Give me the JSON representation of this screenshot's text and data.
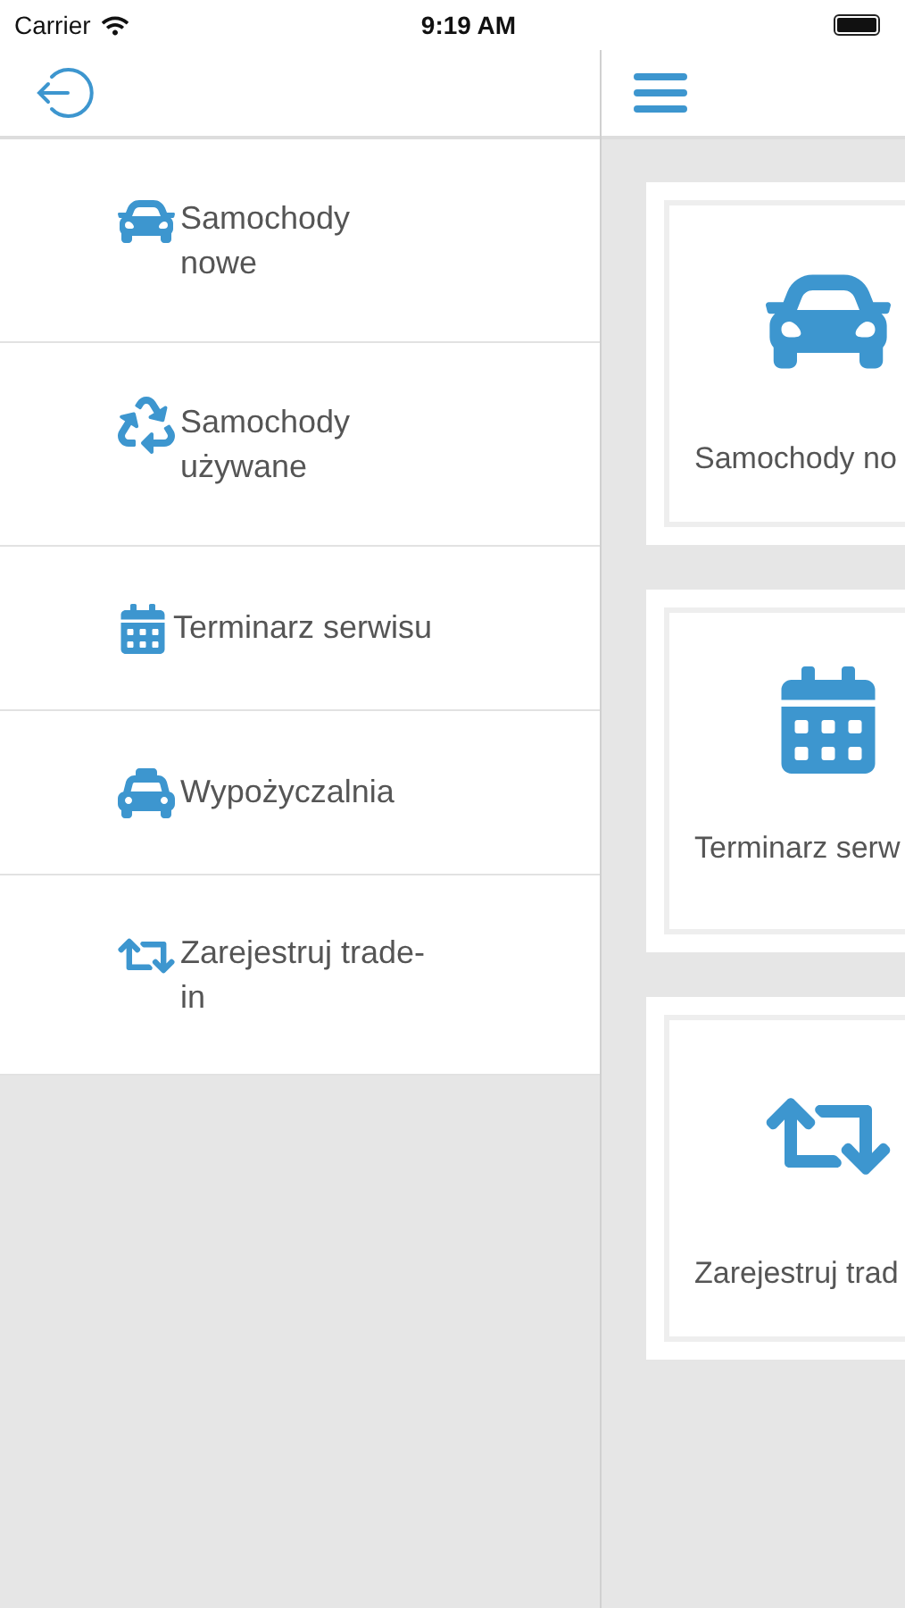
{
  "status_bar": {
    "carrier": "Carrier",
    "time": "9:19 AM"
  },
  "drawer": {
    "items": [
      {
        "kind": "car",
        "lines": [
          "Samochody",
          "nowe"
        ]
      },
      {
        "kind": "recycle",
        "lines": [
          "Samochody",
          "używane"
        ]
      },
      {
        "kind": "calendar",
        "lines": [
          "Terminarz serwisu"
        ]
      },
      {
        "kind": "taxi",
        "lines": [
          "Wypożyczalnia"
        ]
      },
      {
        "kind": "retweet",
        "lines": [
          "Zarejestruj trade-",
          "in"
        ]
      }
    ]
  },
  "tiles": [
    {
      "kind": "car",
      "label": "Samochody no"
    },
    {
      "kind": "calendar",
      "label": "Terminarz serw"
    },
    {
      "kind": "retweet",
      "label": "Zarejestruj trad"
    }
  ]
}
